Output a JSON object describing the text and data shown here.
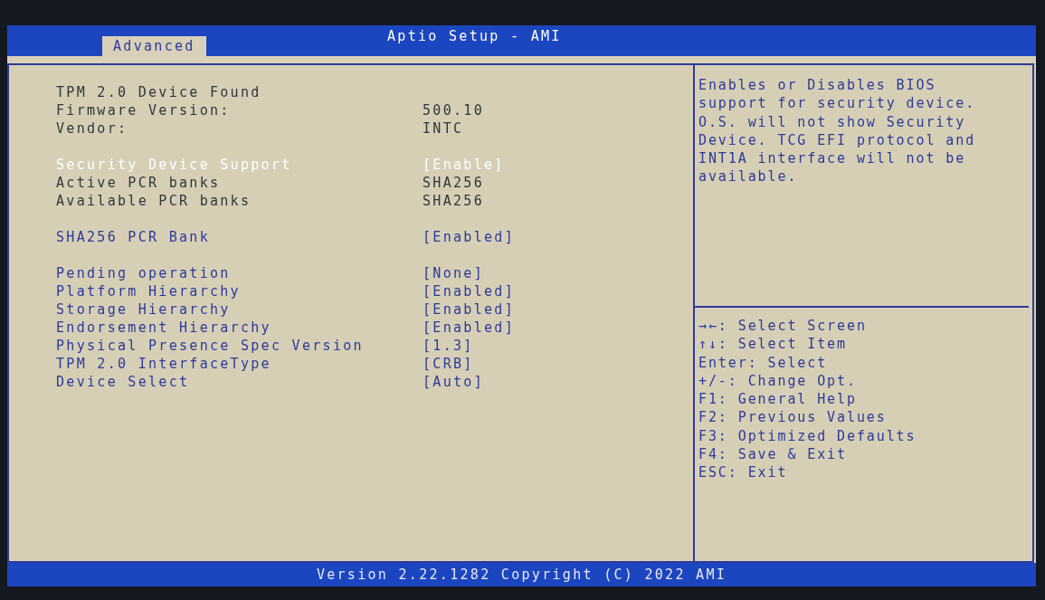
{
  "window": {
    "title": "Aptio Setup - AMI"
  },
  "tabs": [
    {
      "label": "Advanced",
      "selected": true
    }
  ],
  "settings": {
    "groups": [
      {
        "rows": [
          {
            "kind": "info",
            "label": "TPM 2.0 Device Found",
            "selected": false
          },
          {
            "kind": "info",
            "label": "Firmware Version:",
            "value": "500.10",
            "selected": false
          },
          {
            "kind": "info",
            "label": "Vendor:",
            "value": "INTC",
            "selected": false
          }
        ]
      },
      {
        "rows": [
          {
            "kind": "option",
            "label": "Security Device Support",
            "value": "[Enable]",
            "selected": true
          },
          {
            "kind": "info",
            "label": "Active PCR banks",
            "value": "SHA256",
            "selected": false
          },
          {
            "kind": "info",
            "label": "Available PCR banks",
            "value": "SHA256",
            "selected": false
          }
        ]
      },
      {
        "rows": [
          {
            "kind": "option",
            "label": "SHA256 PCR Bank",
            "value": "[Enabled]",
            "selected": false
          }
        ]
      },
      {
        "rows": [
          {
            "kind": "option",
            "label": "Pending operation",
            "value": "[None]",
            "selected": false
          },
          {
            "kind": "option",
            "label": "Platform Hierarchy",
            "value": "[Enabled]",
            "selected": false
          },
          {
            "kind": "option",
            "label": "Storage Hierarchy",
            "value": "[Enabled]",
            "selected": false
          },
          {
            "kind": "option",
            "label": "Endorsement Hierarchy",
            "value": "[Enabled]",
            "selected": false
          },
          {
            "kind": "option",
            "label": "Physical Presence Spec Version",
            "value": "[1.3]",
            "selected": false
          },
          {
            "kind": "option",
            "label": "TPM 2.0 InterfaceType",
            "value": "[CRB]",
            "selected": false
          },
          {
            "kind": "option",
            "label": "Device Select",
            "value": "[Auto]",
            "selected": false
          }
        ]
      }
    ]
  },
  "help": {
    "lines": [
      "Enables or Disables BIOS",
      "support for security device.",
      "O.S. will not show Security",
      "Device. TCG EFI protocol and",
      "INT1A interface will not be",
      "available."
    ]
  },
  "keys": [
    "→←: Select Screen",
    "↑↓: Select Item",
    "Enter: Select",
    "+/-: Change Opt.",
    "F1: General Help",
    "F2: Previous Values",
    "F3: Optimized Defaults",
    "F4: Save & Exit",
    "ESC: Exit"
  ],
  "status_bar": {
    "text": "Version 2.22.1282 Copyright (C) 2022 AMI"
  }
}
